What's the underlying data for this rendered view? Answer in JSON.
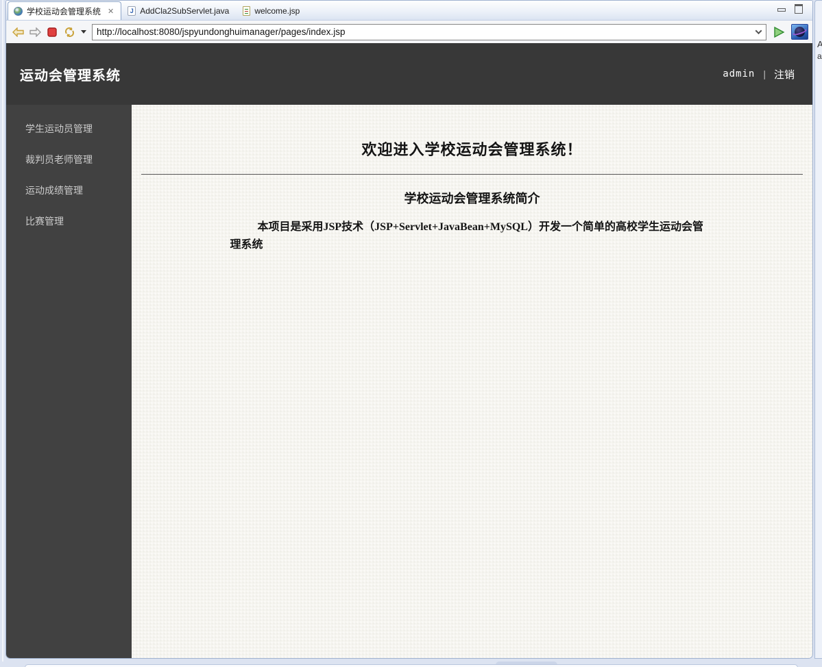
{
  "editor": {
    "tabs": [
      {
        "label": "学校运动会管理系统",
        "icon": "globe",
        "active": true
      },
      {
        "label": "AddCla2SubServlet.java",
        "icon": "java-file",
        "active": false
      },
      {
        "label": "welcome.jsp",
        "icon": "jsp-file",
        "active": false
      }
    ],
    "java_icon_letter": "J"
  },
  "icons": {
    "tab_close": "✕"
  },
  "toolbar": {
    "url": "http://localhost:8080/jspyundonghuimanager/pages/index.jsp"
  },
  "page": {
    "header": {
      "title": "运动会管理系统",
      "username": "admin",
      "divider": "|",
      "logout": "注销"
    },
    "sidebar": {
      "items": [
        "学生运动员管理",
        "裁判员老师管理",
        "运动成绩管理",
        "比赛管理"
      ]
    },
    "content": {
      "welcome_title": "欢迎进入学校运动会管理系统！",
      "section_title": "学校运动会管理系统简介",
      "intro": "本项目是采用JSP技术（JSP+Servlet+JavaBean+MySQL）开发一个简单的高校学生运动会管理系统"
    }
  },
  "right_sliver": {
    "fragments": [
      "A",
      "a"
    ]
  },
  "colors": {
    "header_bg": "#383838",
    "sidebar_bg": "#414141",
    "content_bg": "#f6f5f0",
    "tab_border": "#8ea6c9",
    "go_green": "#57b14d",
    "stop_red": "#cc3333",
    "nav_gold": "#c9a23a"
  }
}
